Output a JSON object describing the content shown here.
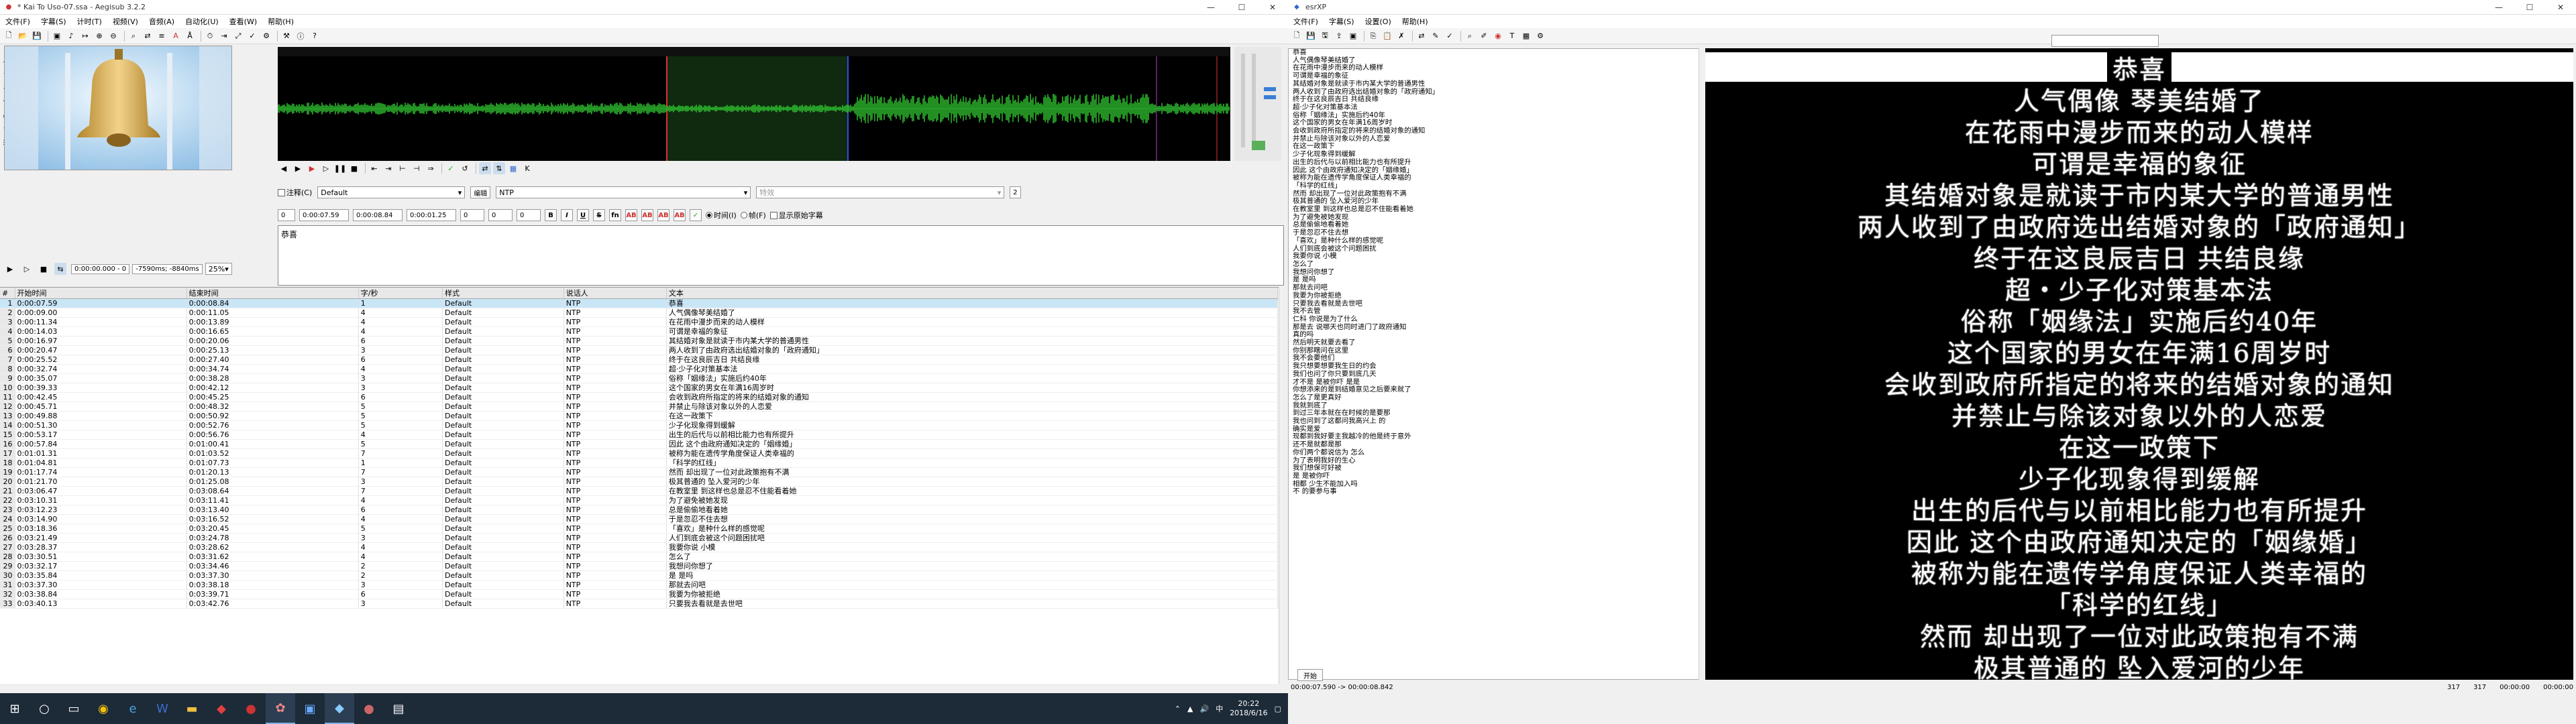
{
  "aegisub": {
    "title": "* Kai To Uso-07.ssa - Aegisub 3.2.2",
    "menu": [
      "文件(F)",
      "字幕(S)",
      "计时(T)",
      "视频(V)",
      "音频(A)",
      "自动化(U)",
      "查看(W)",
      "帮助(H)"
    ],
    "video_time": "0:00:00.000 - 0",
    "video_offset": "-7590ms; -8840ms",
    "zoom": "25%",
    "edit": {
      "comment_label": "注释(C)",
      "style": "Default",
      "edit_label": "编辑",
      "actor": "NTP",
      "effect_placeholder": "特效",
      "line_count": "2",
      "layer": "0",
      "start": "0:00:07.59",
      "end": "0:00:08.84",
      "duration": "0:00:01.25",
      "margin_l": "0",
      "margin_r": "0",
      "margin_v": "0",
      "time_label": "时间(I)",
      "frame_label": "帧(F)",
      "show_original": "显示原始字幕",
      "text": "恭喜"
    },
    "grid_headers": [
      "#",
      "开始时间",
      "结束时间",
      "字/秒",
      "样式",
      "说话人",
      "文本"
    ],
    "rows": [
      [
        "1",
        "0:00:07.59",
        "0:00:08.84",
        "1",
        "Default",
        "NTP",
        "恭喜"
      ],
      [
        "2",
        "0:00:09.00",
        "0:00:11.05",
        "4",
        "Default",
        "NTP",
        "人气偶像琴美结婚了"
      ],
      [
        "3",
        "0:00:11.34",
        "0:00:13.89",
        "4",
        "Default",
        "NTP",
        "在花雨中漫步而来的动人模样"
      ],
      [
        "4",
        "0:00:14.03",
        "0:00:16.65",
        "4",
        "Default",
        "NTP",
        "可谓是幸福的象征"
      ],
      [
        "5",
        "0:00:16.97",
        "0:00:20.06",
        "6",
        "Default",
        "NTP",
        "其结婚对象是就读于市内某大学的普通男性"
      ],
      [
        "6",
        "0:00:20.47",
        "0:00:25.13",
        "3",
        "Default",
        "NTP",
        "两人收到了由政府选出结婚对象的「政府通知」"
      ],
      [
        "7",
        "0:00:25.52",
        "0:00:27.40",
        "6",
        "Default",
        "NTP",
        "终于在这良辰吉日 共结良缘"
      ],
      [
        "8",
        "0:00:32.74",
        "0:00:34.74",
        "4",
        "Default",
        "NTP",
        "超·少子化对策基本法"
      ],
      [
        "9",
        "0:00:35.07",
        "0:00:38.28",
        "3",
        "Default",
        "NTP",
        "俗称「姻缘法」实施后约40年"
      ],
      [
        "10",
        "0:00:39.33",
        "0:00:42.12",
        "3",
        "Default",
        "NTP",
        "这个国家的男女在年满16周岁时"
      ],
      [
        "11",
        "0:00:42.45",
        "0:00:45.25",
        "6",
        "Default",
        "NTP",
        "会收到政府所指定的将来的结婚对象的通知"
      ],
      [
        "12",
        "0:00:45.71",
        "0:00:48.32",
        "5",
        "Default",
        "NTP",
        "并禁止与除该对象以外的人恋爱"
      ],
      [
        "13",
        "0:00:49.88",
        "0:00:50.92",
        "5",
        "Default",
        "NTP",
        "在这一政策下"
      ],
      [
        "14",
        "0:00:51.30",
        "0:00:52.76",
        "5",
        "Default",
        "NTP",
        "少子化现象得到缓解"
      ],
      [
        "15",
        "0:00:53.17",
        "0:00:56.76",
        "4",
        "Default",
        "NTP",
        "出生的后代与以前相比能力也有所提升"
      ],
      [
        "16",
        "0:00:57.84",
        "0:01:00.41",
        "5",
        "Default",
        "NTP",
        "因此 这个由政府通知决定的「姻缘婚」"
      ],
      [
        "17",
        "0:01:01.31",
        "0:01:03.52",
        "7",
        "Default",
        "NTP",
        "被称为能在遗传学角度保证人类幸福的"
      ],
      [
        "18",
        "0:01:04.81",
        "0:01:07.73",
        "1",
        "Default",
        "NTP",
        "「科学的红线」"
      ],
      [
        "19",
        "0:01:17.74",
        "0:01:20.13",
        "7",
        "Default",
        "NTP",
        "然而 却出现了一位对此政策抱有不满"
      ],
      [
        "20",
        "0:01:21.70",
        "0:01:25.08",
        "3",
        "Default",
        "NTP",
        "极其普通的 坠入爱河的少年"
      ],
      [
        "21",
        "0:03:06.47",
        "0:03:08.64",
        "7",
        "Default",
        "NTP",
        "在教室里 到这样也总是忍不住能看着她"
      ],
      [
        "22",
        "0:03:10.31",
        "0:03:11.41",
        "4",
        "Default",
        "NTP",
        "为了避免被她发现"
      ],
      [
        "23",
        "0:03:12.23",
        "0:03:13.40",
        "6",
        "Default",
        "NTP",
        "总是偷偷地看着她"
      ],
      [
        "24",
        "0:03:14.90",
        "0:03:16.52",
        "4",
        "Default",
        "NTP",
        "于是忽忍不住去想"
      ],
      [
        "25",
        "0:03:18.36",
        "0:03:20.45",
        "5",
        "Default",
        "NTP",
        "「喜欢」是种什么样的感觉呢"
      ],
      [
        "26",
        "0:03:21.49",
        "0:03:24.78",
        "3",
        "Default",
        "NTP",
        "人们到底会被这个问题困扰吧"
      ],
      [
        "27",
        "0:03:28.37",
        "0:03:28.62",
        "4",
        "Default",
        "NTP",
        "我要你说 小模"
      ],
      [
        "28",
        "0:03:30.51",
        "0:03:31.62",
        "4",
        "Default",
        "NTP",
        "怎么了"
      ],
      [
        "29",
        "0:03:32.17",
        "0:03:34.46",
        "2",
        "Default",
        "NTP",
        "我想问你想了"
      ],
      [
        "30",
        "0:03:35.84",
        "0:03:37.30",
        "2",
        "Default",
        "NTP",
        "是 是吗"
      ],
      [
        "31",
        "0:03:37.30",
        "0:03:38.18",
        "3",
        "Default",
        "NTP",
        "那就去问吧"
      ],
      [
        "32",
        "0:03:38.84",
        "0:03:39.71",
        "6",
        "Default",
        "NTP",
        "我要为你被拒绝"
      ],
      [
        "33",
        "0:03:40.13",
        "0:03:42.76",
        "3",
        "Default",
        "NTP",
        "只要我去看就是去世吧"
      ]
    ],
    "taskbar_time": "20:22",
    "taskbar_date": "2018/6/16"
  },
  "esr": {
    "title": "esrXP",
    "menu": [
      "文件(F)",
      "字幕(S)",
      "设置(O)",
      "帮助(H)"
    ],
    "list_header": "恭喜",
    "list": [
      "人气偶像琴美结婚了",
      "在花雨中漫步而来的动人模样",
      "可谓是幸福的象征",
      "其结婚对象是就读于市内某大学的普通男性",
      "两人收到了由政府选出结婚对象的「政府通知」",
      "终于在这良辰吉日 共结良缘",
      "超·少子化对策基本法",
      "俗称「姻缘法」实施后约40年",
      "这个国家的男女在年满16周岁时",
      "会收到政府所指定的将来的结婚对象的通知",
      "并禁止与除该对象以外的人恋爱",
      "在这一政策下",
      "少子化现象得到缓解",
      "出生的后代与以前相比能力也有所提升",
      "因此 这个由政府通知决定的「姻缘婚」",
      "被称为能在遗传学角度保证人类幸福的",
      "「科学的红线」",
      "然而 却出现了一位对此政策抱有不满",
      "极其普通的 坠入爱河的少年",
      "在教室里 到这样也总是忍不住能看着她",
      "为了避免被她发现",
      "总是偷偷地看着她",
      "于是忽忍不住去想",
      "「喜欢」是种什么样的感觉呢",
      "人们到底会被这个问题困扰",
      "我要你说 小模",
      "怎么了",
      "我想问你想了",
      "是 是吗",
      "那就去问吧",
      "我要为你被拒绝",
      "只要我去看就是去世吧",
      "我不去管",
      "仁科 你说是为了什么",
      "那是去 说哪天也同时进门了政府通知",
      "真的吗",
      "然后明天就要去看了",
      "你别那瞎问在这里",
      "我不会要他们",
      "我只想要想要我生日的约会",
      "我们也问了你只要到底几天",
      "才不是 是被你吓 是是",
      "你想添来的是到结婚意见之后要来就了",
      "怎么了是更真好",
      "我就到底了",
      "到过三年本就在在时候的是要那",
      "我也问到了这都问我高兴上 的",
      "确实是爱",
      "现都到我好要主我越冷的他是终于意外",
      "还不是就都是那",
      "你们两个都说信为 怎么",
      "为了表明我好的生心",
      "我们想保可好被",
      "是 是被你吓",
      "相都 少生不能加入吗",
      "不 的要参与事"
    ],
    "preview": [
      "恭喜",
      "人气偶像 琴美结婚了",
      "在花雨中漫步而来的动人模样",
      "可谓是幸福的象征",
      "其结婚对象是就读于市内某大学的普通男性",
      "两人收到了由政府选出结婚对象的「政府通知」",
      "终于在这良辰吉日 共结良缘",
      "超・少子化对策基本法",
      "俗称「姻缘法」实施后约40年",
      "这个国家的男女在年满16周岁时",
      "会收到政府所指定的将来的结婚对象的通知",
      "并禁止与除该对象以外的人恋爱",
      "在这一政策下",
      "少子化现象得到缓解",
      "出生的后代与以前相比能力也有所提升",
      "因此 这个由政府通知决定的「姻缘婚」",
      "被称为能在遗传学角度保证人类幸福的",
      "「科学的红线」",
      "然而 却出现了一位对此政策抱有不满",
      "极其普通的 坠入爱河的少年"
    ],
    "open_button": "开始",
    "status_time": "00:00:07.590 -> 00:00:08.842",
    "status_count_a": "317",
    "status_count_b": "317",
    "status_t1": "00:00:00",
    "status_t2": "00:00:00"
  }
}
